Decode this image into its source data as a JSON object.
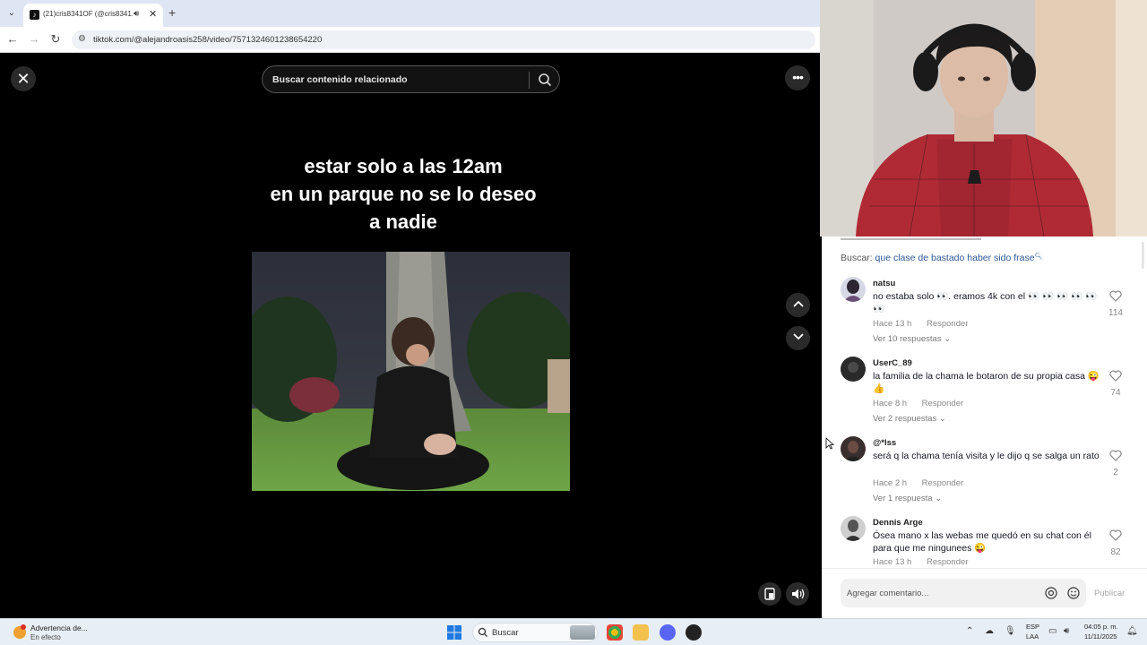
{
  "browser": {
    "tab_title": "(21)cris8341OF (@cris8341...",
    "close_tab": "✕",
    "new_tab": "+",
    "url": "tiktok.com/@alejandroasis258/video/7571324601238654220"
  },
  "video": {
    "search_placeholder": "Buscar contenido relacionado",
    "caption_lines": [
      "estar solo a las 12am",
      "en un parque no se lo deseo",
      "a nadie"
    ],
    "close_symbol": "✕",
    "more_symbol": "•••"
  },
  "comments": {
    "search_label": "Buscar:",
    "search_query": "que clase de bastado haber sido frase",
    "items": [
      {
        "user": "natsu",
        "text": "no estaba solo 👀. eramos 4k con el 👀 👀 👀 👀 👀 👀",
        "time": "Hace 13 h",
        "reply": "Responder",
        "replies": "Ver 10 respuestas ⌄",
        "likes": "114"
      },
      {
        "user": "UserC_89",
        "text": "la familia de la chama le botaron de su propia casa 😜 👍",
        "time": "Hace 8 h",
        "reply": "Responder",
        "replies": "Ver 2 respuestas ⌄",
        "likes": "74"
      },
      {
        "user": "@*lss",
        "text": "será q la chama tenía visita y le dijo q se salga un rato",
        "time": "Hace 2 h",
        "reply": "Responder",
        "replies": "Ver 1 respuesta ⌄",
        "likes": "2"
      },
      {
        "user": "Dennis Arge",
        "text": "Ósea mano x las webas me quedó en su chat con él para que me ningunees 😜",
        "time": "Hace 13 h",
        "reply": "Responder",
        "likes": "82"
      }
    ],
    "input_placeholder": "Agregar comentario...",
    "publish_label": "Publicar"
  },
  "taskbar": {
    "weather_title": "Advertencia de...",
    "weather_sub": "En efecto",
    "search_label": "Buscar",
    "lang_1": "ESP",
    "lang_2": "LAA",
    "time": "04:05 p. m.",
    "date": "11/11/2025"
  },
  "colors": {
    "accent_link": "#2b5797",
    "tiktok_black": "#000000",
    "panel_bg": "#ffffff"
  }
}
